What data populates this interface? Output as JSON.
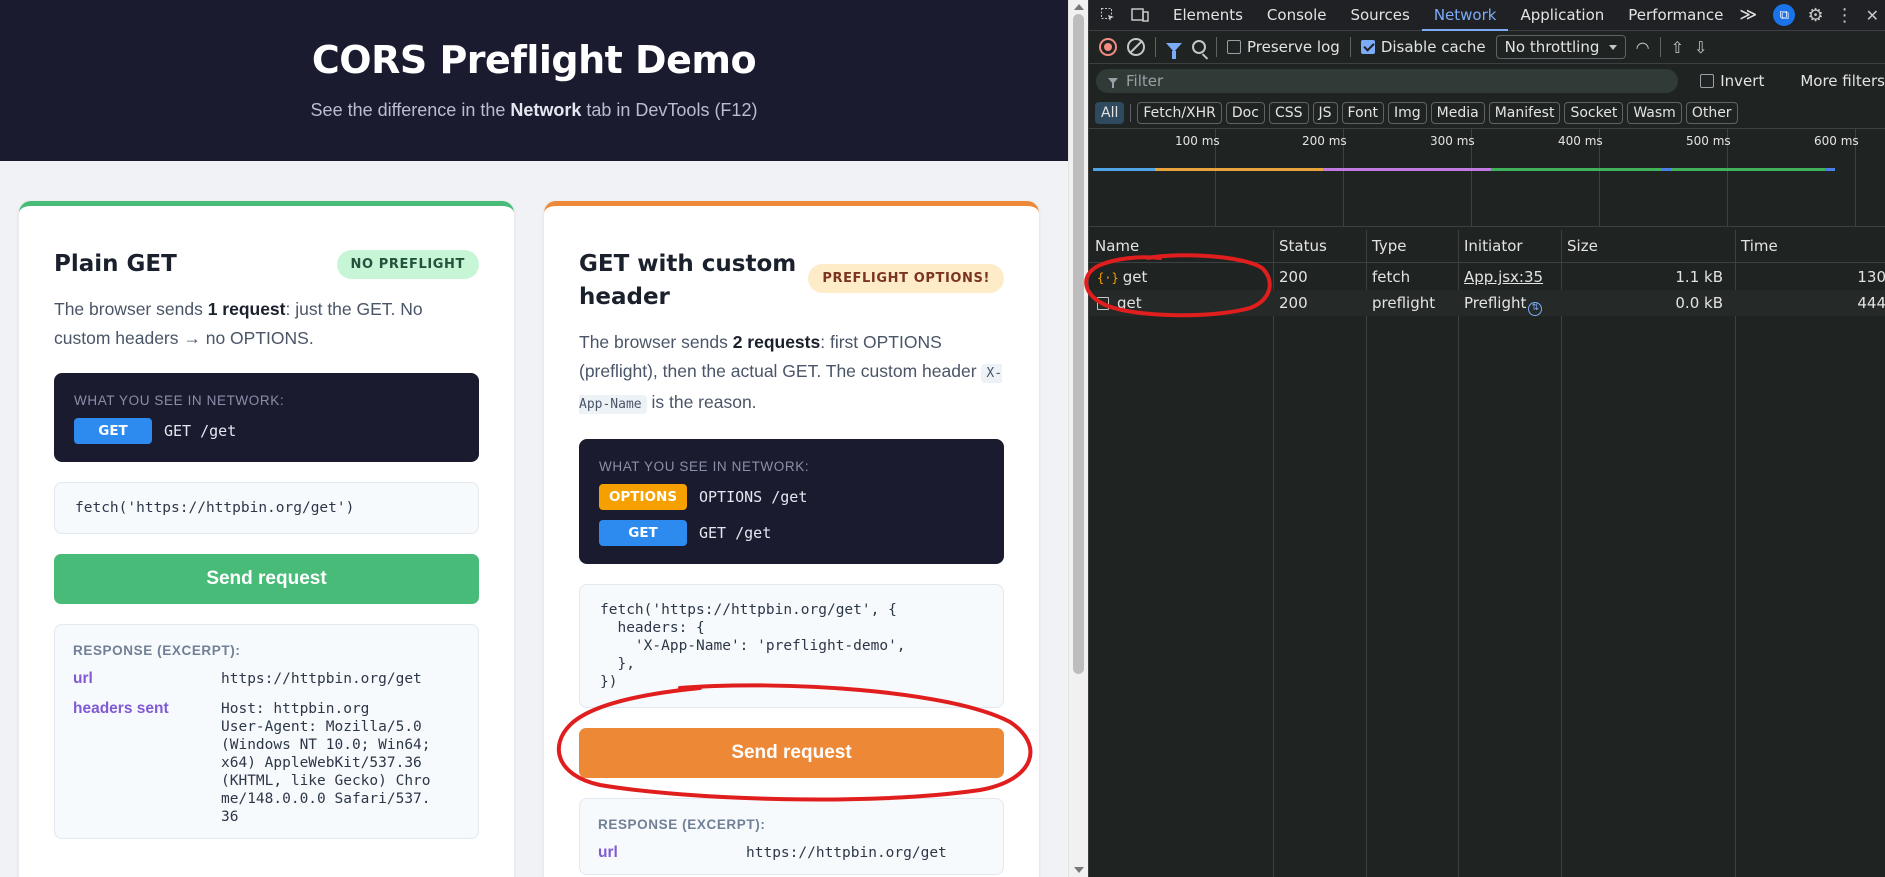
{
  "hero": {
    "title": "CORS Preflight Demo",
    "sub_before": "See the difference in the ",
    "sub_bold": "Network",
    "sub_after": " tab in DevTools (F12)"
  },
  "plain_card": {
    "title": "Plain GET",
    "badge": "NO PREFLIGHT",
    "desc_before": "The browser sends ",
    "desc_bold": "1 request",
    "desc_after": ": just the GET. No custom headers → no OPTIONS.",
    "network_label": "WHAT YOU SEE IN NETWORK:",
    "network_rows": [
      {
        "method": "GET",
        "path": "GET /get"
      }
    ],
    "code": "fetch('https://httpbin.org/get')",
    "button": "Send request",
    "response_label": "RESPONSE (EXCERPT):",
    "response": [
      {
        "key": "url",
        "value": "https://httpbin.org/get"
      },
      {
        "key": "headers sent",
        "value": "Host: httpbin.org\nUser-Agent: Mozilla/5.0\n(Windows NT 10.0; Win64;\nx64) AppleWebKit/537.36\n(KHTML, like Gecko) Chro\nme/148.0.0.0 Safari/537.\n36"
      }
    ]
  },
  "custom_card": {
    "title_line1": "GET with custom",
    "title_line2": "header",
    "badge": "PREFLIGHT OPTIONS!",
    "desc_before": "The browser sends ",
    "desc_bold": "2 requests",
    "desc_mid": ": first OPTIONS (preflight), then the actual GET. The custom header ",
    "desc_code": "X-App-Name",
    "desc_after": " is the reason.",
    "network_label": "WHAT YOU SEE IN NETWORK:",
    "network_rows": [
      {
        "method": "OPTIONS",
        "path": "OPTIONS /get"
      },
      {
        "method": "GET",
        "path": "GET /get"
      }
    ],
    "code": "fetch('https://httpbin.org/get', {\n  headers: {\n    'X-App-Name': 'preflight-demo',\n  },\n})",
    "button": "Send request",
    "response_label": "RESPONSE (EXCERPT):",
    "response": [
      {
        "key": "url",
        "value": "https://httpbin.org/get"
      }
    ]
  },
  "devtools": {
    "tabs": [
      "Elements",
      "Console",
      "Sources",
      "Network",
      "Application",
      "Performance"
    ],
    "active_tab": "Network",
    "more_tabs": "≫",
    "toolbar": {
      "preserve_log": "Preserve log",
      "preserve_log_checked": false,
      "disable_cache": "Disable cache",
      "disable_cache_checked": true,
      "throttling": "No throttling"
    },
    "filter_placeholder": "Filter",
    "invert": "Invert",
    "more_filters": "More filters",
    "types": [
      "All",
      "Fetch/XHR",
      "Doc",
      "CSS",
      "JS",
      "Font",
      "Img",
      "Media",
      "Manifest",
      "Socket",
      "Wasm",
      "Other"
    ],
    "active_type": "All",
    "timeline_ticks": [
      "100 ms",
      "200 ms",
      "300 ms",
      "400 ms",
      "500 ms",
      "600 ms"
    ],
    "columns": [
      "Name",
      "Status",
      "Type",
      "Initiator",
      "Size",
      "Time"
    ],
    "rows": [
      {
        "name": "get",
        "status": "200",
        "type": "fetch",
        "initiator": "App.jsx:35",
        "size": "1.1 kB",
        "time": "130"
      },
      {
        "name": "get",
        "status": "200",
        "type": "preflight",
        "initiator": "Preflight",
        "size": "0.0 kB",
        "time": "444"
      }
    ]
  },
  "colors": {
    "green": "#48bb78",
    "orange": "#ed8936",
    "annotation_red": "#e01e1e",
    "devtools_accent": "#7cacf8"
  }
}
